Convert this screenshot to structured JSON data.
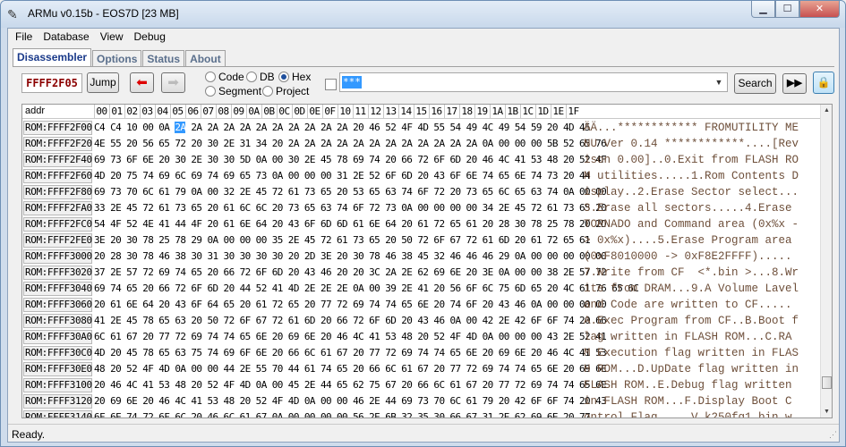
{
  "window": {
    "title": "ARMu v0.15b - EOS7D [23 MB]",
    "minimize_glyph": "▁",
    "maximize_glyph": "☐",
    "close_glyph": "✕",
    "app_icon": "tool-icon"
  },
  "menubar": [
    "File",
    "Database",
    "View",
    "Debug"
  ],
  "tabs": [
    "Disassembler",
    "Options",
    "Status",
    "About"
  ],
  "toolbar": {
    "address": "FFFF2F05",
    "jump_label": "Jump",
    "back_icon": "red-left-arrow-icon",
    "forward_icon": "disabled-right-arrow-icon",
    "radios": {
      "code": "Code",
      "db": "DB",
      "hex": "Hex",
      "segment": "Segment",
      "project": "Project",
      "selected": "Hex"
    },
    "search_value": "***",
    "search_label": "Search",
    "run_label": "▶▶",
    "lock_icon": "lock-icon"
  },
  "grid": {
    "addr_header": "addr",
    "columns": [
      "00",
      "01",
      "02",
      "03",
      "04",
      "05",
      "06",
      "07",
      "08",
      "09",
      "0A",
      "0B",
      "0C",
      "0D",
      "0E",
      "0F",
      "10",
      "11",
      "12",
      "13",
      "14",
      "15",
      "16",
      "17",
      "18",
      "19",
      "1A",
      "1B",
      "1C",
      "1D",
      "1E",
      "1F"
    ],
    "rows": [
      {
        "addr": "ROM:FFFF2F00",
        "hex_pre": "C4 C4 10 00 0A ",
        "hex_sel": "2A",
        "hex_post": " 2A 2A 2A 2A 2A 2A 2A 2A 2A 2A 20 46 52 4F 4D 55 54 49 4C 49 54 59 20 4D 45",
        "ascii": "ÄÄ...************ FROMUTILITY ME"
      },
      {
        "addr": "ROM:FFFF2F20",
        "hex_pre": "4E 55 20 56 65 72 20 30 2E 31 34 20 2A 2A 2A 2A 2A 2A 2A 2A 2A 2A 2A 2A 0A 00 00 00 5B 52 65 76",
        "hex_sel": "",
        "hex_post": "",
        "ascii": "NU Ver 0.14 ************....[Rev"
      },
      {
        "addr": "ROM:FFFF2F40",
        "hex_pre": "69 73 6F 6E 20 30 2E 30 30 5D 0A 00 30 2E 45 78 69 74 20 66 72 6F 6D 20 46 4C 41 53 48 20 52 4F",
        "hex_sel": "",
        "hex_post": "",
        "ascii": "ison 0.00]..0.Exit from FLASH RO"
      },
      {
        "addr": "ROM:FFFF2F60",
        "hex_pre": "4D 20 75 74 69 6C 69 74 69 65 73 0A 00 00 00 31 2E 52 6F 6D 20 43 6F 6E 74 65 6E 74 73 20 44",
        "hex_sel": "",
        "hex_post": "",
        "ascii": "M utilities.....1.Rom Contents D"
      },
      {
        "addr": "ROM:FFFF2F80",
        "hex_pre": "69 73 70 6C 61 79 0A 00 32 2E 45 72 61 73 65 20 53 65 63 74 6F 72 20 73 65 6C 65 63 74 0A 00 00",
        "hex_sel": "",
        "hex_post": "",
        "ascii": "isplay..2.Erase Sector select..."
      },
      {
        "addr": "ROM:FFFF2FA0",
        "hex_pre": "33 2E 45 72 61 73 65 20 61 6C 6C 20 73 65 63 74 6F 72 73 0A 00 00 00 00 34 2E 45 72 61 73 65 20",
        "hex_sel": "",
        "hex_post": "",
        "ascii": "3.Erase all sectors.....4.Erase "
      },
      {
        "addr": "ROM:FFFF2FC0",
        "hex_pre": "54 4F 52 4E 41 44 4F 20 61 6E 64 20 43 6F 6D 6D 61 6E 64 20 61 72 65 61 20 28 30 78 25 78 20 2D",
        "hex_sel": "",
        "hex_post": "",
        "ascii": "TORNADO and Command area (0x%x -"
      },
      {
        "addr": "ROM:FFFF2FE0",
        "hex_pre": "3E 20 30 78 25 78 29 0A 00 00 00 35 2E 45 72 61 73 65 20 50 72 6F 67 72 61 6D 20 61 72 65 61",
        "hex_sel": "",
        "hex_post": "",
        "ascii": "> 0x%x)....5.Erase Program area"
      },
      {
        "addr": "ROM:FFFF3000",
        "hex_pre": "20 28 30 78 46 38 30 31 30 30 30 30 20 2D 3E 20 30 78 46 38 45 32 46 46 46 29 0A 00 00 00 00 00",
        "hex_sel": "",
        "hex_post": "",
        "ascii": "(0xF8010000 -> 0xF8E2FFFF)....."
      },
      {
        "addr": "ROM:FFFF3020",
        "hex_pre": "37 2E 57 72 69 74 65 20 66 72 6F 6D 20 43 46 20 20 3C 2A 2E 62 69 6E 20 3E 0A 00 00 38 2E 57 72",
        "hex_sel": "",
        "hex_post": "",
        "ascii": "7.Write from CF  <*.bin >...8.Wr"
      },
      {
        "addr": "ROM:FFFF3040",
        "hex_pre": "69 74 65 20 66 72 6F 6D 20 44 52 41 4D 2E 2E 2E 0A 00 39 2E 41 20 56 6F 6C 75 6D 65 20 4C 61 76 65 6C",
        "hex_sel": "",
        "hex_post": "",
        "ascii": "ite from DRAM...9.A Volume Lavel"
      },
      {
        "addr": "ROM:FFFF3060",
        "hex_pre": "20 61 6E 64 20 43 6F 64 65 20 61 72 65 20 77 72 69 74 74 65 6E 20 74 6F 20 43 46 0A 00 00 00 00",
        "hex_sel": "",
        "hex_post": "",
        "ascii": "and Code are written to CF....."
      },
      {
        "addr": "ROM:FFFF3080",
        "hex_pre": "41 2E 45 78 65 63 20 50 72 6F 67 72 61 6D 20 66 72 6F 6D 20 43 46 0A 00 42 2E 42 6F 6F 74 20 66",
        "hex_sel": "",
        "hex_post": "",
        "ascii": "A.Exec Program from CF..B.Boot f"
      },
      {
        "addr": "ROM:FFFF30A0",
        "hex_pre": "6C 61 67 20 77 72 69 74 74 65 6E 20 69 6E 20 46 4C 41 53 48 20 52 4F 4D 0A 00 00 00 43 2E 52 41",
        "hex_sel": "",
        "hex_post": "",
        "ascii": "lag written in FLASH ROM...C.RA"
      },
      {
        "addr": "ROM:FFFF30C0",
        "hex_pre": "4D 20 45 78 65 63 75 74 69 6F 6E 20 66 6C 61 67 20 77 72 69 74 74 65 6E 20 69 6E 20 46 4C 41 53",
        "hex_sel": "",
        "hex_post": "",
        "ascii": "M Execution flag written in FLAS"
      },
      {
        "addr": "ROM:FFFF30E0",
        "hex_pre": "48 20 52 4F 4D 0A 00 00 44 2E 55 70 44 61 74 65 20 66 6C 61 67 20 77 72 69 74 74 65 6E 20 69 6E",
        "hex_sel": "",
        "hex_post": "",
        "ascii": "H ROM...D.UpDate flag written in"
      },
      {
        "addr": "ROM:FFFF3100",
        "hex_pre": "20 46 4C 41 53 48 20 52 4F 4D 0A 00 45 2E 44 65 62 75 67 20 66 6C 61 67 20 77 72 69 74 74 65 6E",
        "hex_sel": "",
        "hex_post": "",
        "ascii": "FLASH ROM..E.Debug flag written"
      },
      {
        "addr": "ROM:FFFF3120",
        "hex_pre": "20 69 6E 20 46 4C 41 53 48 20 52 4F 4D 0A 00 00 46 2E 44 69 73 70 6C 61 79 20 42 6F 6F 74 20 43",
        "hex_sel": "",
        "hex_post": "",
        "ascii": "in FLASH ROM...F.Display Boot C"
      },
      {
        "addr": "ROM:FFFF3140",
        "hex_pre": "6F 6E 74 72 6F 6C 20 46 6C 61 67 0A 00 00 00 00 56 2E 6B 32 35 30 66 67 31 2E 62 69 6E 20 77",
        "hex_sel": "",
        "hex_post": "",
        "ascii": "ontrol Flag.....V.k250fg1.bin w"
      }
    ]
  },
  "statusbar": {
    "text": "Ready."
  }
}
